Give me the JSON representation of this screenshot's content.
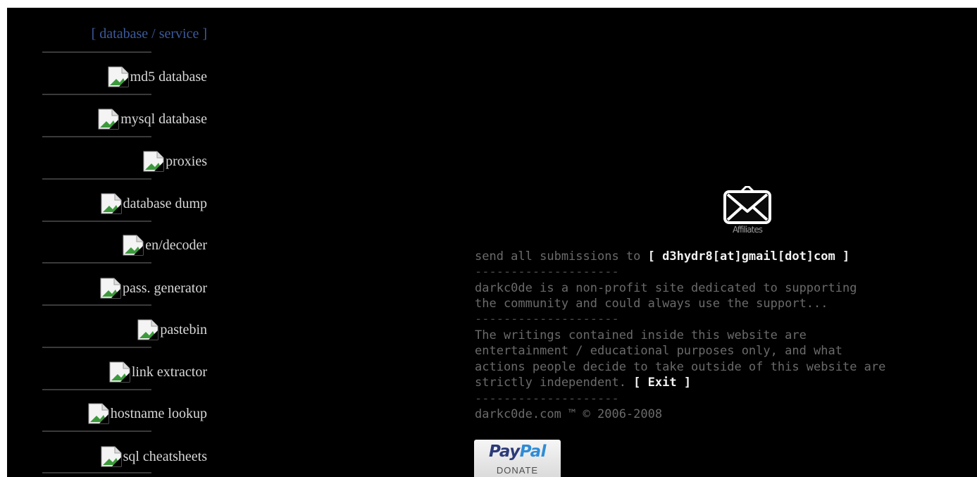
{
  "sidebar": {
    "header": "[ database / service ]",
    "items": [
      {
        "label": "md5 database",
        "icon": "broken-image-icon"
      },
      {
        "label": "mysql database",
        "icon": "broken-image-icon"
      },
      {
        "label": "proxies",
        "icon": "broken-image-icon"
      },
      {
        "label": "database dump",
        "icon": "broken-image-icon"
      },
      {
        "label": "en/decoder",
        "icon": "broken-image-icon"
      },
      {
        "label": "pass. generator",
        "icon": "broken-image-icon"
      },
      {
        "label": "pastebin",
        "icon": "broken-image-icon"
      },
      {
        "label": "link extractor",
        "icon": "broken-image-icon"
      },
      {
        "label": "hostname lookup",
        "icon": "broken-image-icon"
      },
      {
        "label": "sql cheatsheets",
        "icon": "broken-image-icon"
      }
    ]
  },
  "main": {
    "mail_icon_alt": "Affiliates",
    "submissions_prefix": "send all submissions to ",
    "submissions_email": "[ d3hydr8[at]gmail[dot]com ]",
    "separator": "--------------------",
    "nonprofit_line1": "darkc0de is a non-profit site dedicated to supporting",
    "nonprofit_line2": "the community and could always use the support...",
    "disclaimer_line1": "The writings contained inside this website are",
    "disclaimer_line2": "entertainment / educational purposes only, and what",
    "disclaimer_line3": "actions people decide to take outside of this website are",
    "disclaimer_line4": "strictly independent. ",
    "exit_label": "[ Exit ]",
    "copyright": "darkc0de.com ™ © 2006-2008",
    "paypal": {
      "pay": "Pay",
      "pal": "Pal",
      "donate": "DONATE"
    }
  },
  "colors": {
    "background": "#000000",
    "sidebar_header": "#3c5a9a",
    "sidebar_text": "#d8d8d8",
    "body_text": "#6a6a6a",
    "highlight_text": "#f2f2f2"
  }
}
